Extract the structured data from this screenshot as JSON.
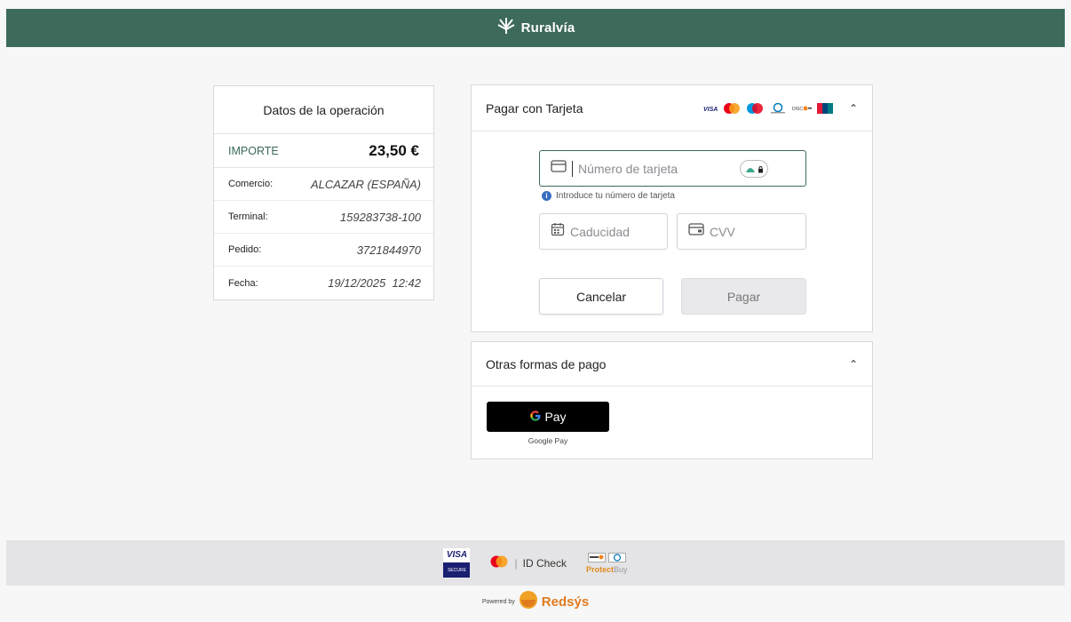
{
  "header": {
    "brand_name": "Ruralvía"
  },
  "details": {
    "title": "Datos de la operación",
    "amount_label": "IMPORTE",
    "amount_value": "23,50 €",
    "rows": [
      {
        "label": "Comercio:",
        "value": "ALCAZAR (ESPAÑA)"
      },
      {
        "label": "Terminal:",
        "value": "159283738-100"
      },
      {
        "label": "Pedido:",
        "value": "3721844970"
      },
      {
        "label": "Fecha:",
        "value": "19/12/2025  12:42"
      }
    ]
  },
  "card_payment": {
    "title": "Pagar con Tarjeta",
    "card_number_placeholder": "Número de tarjeta",
    "card_number_hint": "Introduce tu número de tarjeta",
    "expiry_placeholder": "Caducidad",
    "cvv_placeholder": "CVV",
    "cancel_label": "Cancelar",
    "pay_label": "Pagar",
    "brand_logos": [
      "visa",
      "mastercard",
      "maestro",
      "diners",
      "discover",
      "unionpay"
    ]
  },
  "other_methods": {
    "title": "Otras formas de pago",
    "gpay_button_text": "Pay",
    "gpay_label": "Google Pay"
  },
  "footer": {
    "visa_secure_top": "VISA",
    "visa_secure_bottom": "SECURE",
    "id_check": "ID Check",
    "protect_buy_a": "Protect",
    "protect_buy_b": "Buy",
    "powered_by": "Powered by",
    "redsys": "Redsýs"
  },
  "colors": {
    "brand_green": "#3d6a5b",
    "redsys_orange": "#e07b1d",
    "background": "#f7f7f8"
  }
}
